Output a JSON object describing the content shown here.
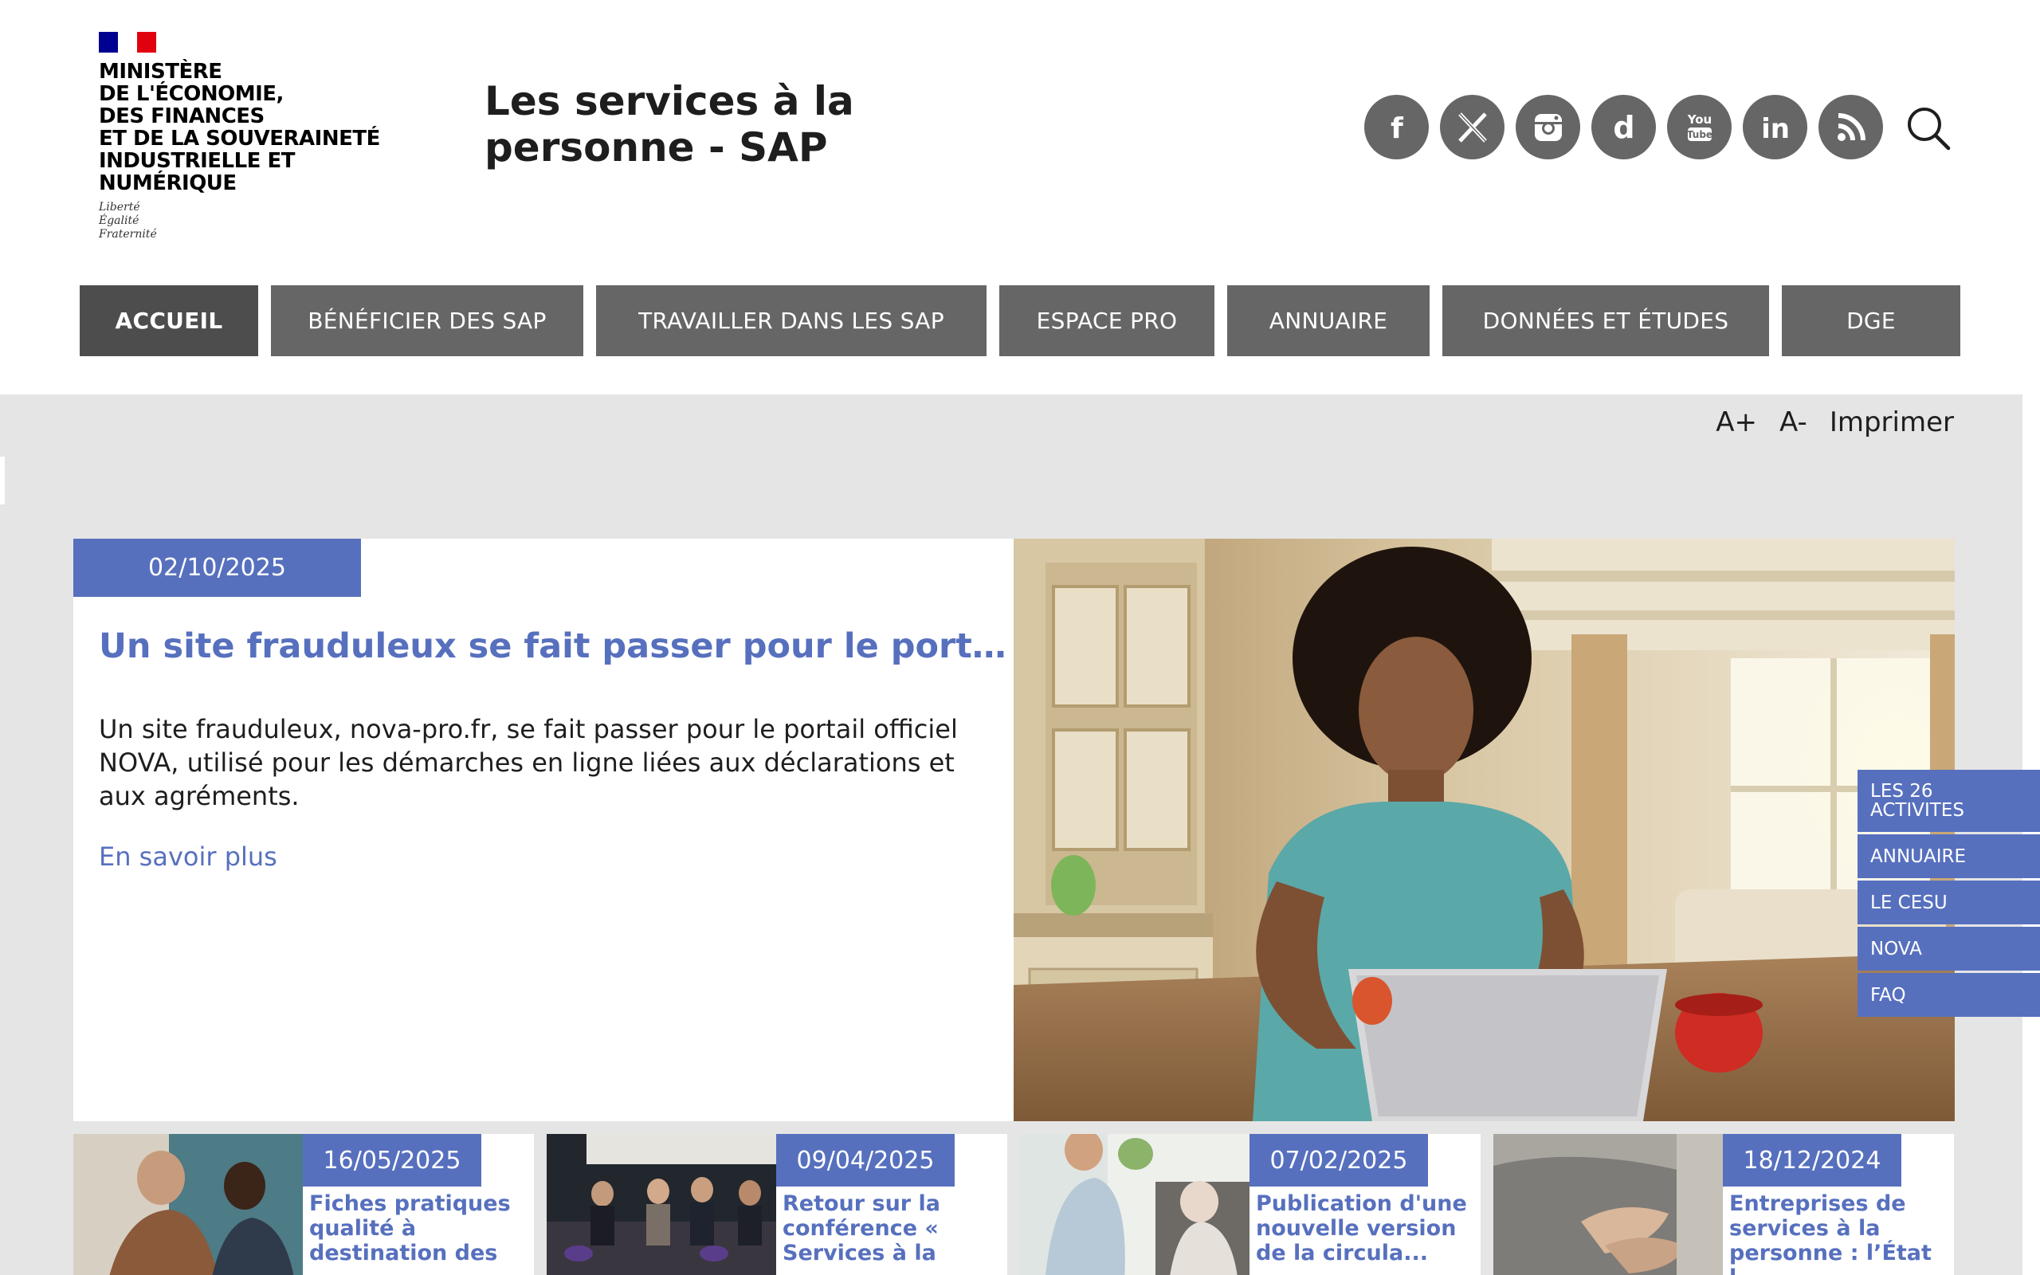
{
  "header": {
    "ministry": "MINISTÈRE\nDE L'ÉCONOMIE,\nDES FINANCES\nET DE LA SOUVERAINETÉ\nINDUSTRIELLE ET NUMÉRIQUE",
    "motto": "Liberté\nÉgalité\nFraternité",
    "site_title": "Les services à la\npersonne - SAP",
    "socials": [
      {
        "icon": "facebook-icon",
        "glyph": "f"
      },
      {
        "icon": "x-icon",
        "glyph": "X"
      },
      {
        "icon": "instagram-icon",
        "glyph": ""
      },
      {
        "icon": "dailymotion-icon",
        "glyph": "d"
      },
      {
        "icon": "youtube-icon",
        "glyph": "You\nTube"
      },
      {
        "icon": "linkedin-icon",
        "glyph": "in"
      },
      {
        "icon": "rss-icon",
        "glyph": ""
      }
    ],
    "search_icon": "search-icon"
  },
  "nav": [
    {
      "label": "ACCUEIL",
      "active": true
    },
    {
      "label": "BÉNÉFICIER DES SAP"
    },
    {
      "label": "TRAVAILLER DANS LES SAP"
    },
    {
      "label": "ESPACE PRO"
    },
    {
      "label": "ANNUAIRE"
    },
    {
      "label": "DONNÉES ET ÉTUDES"
    },
    {
      "label": "DGE"
    }
  ],
  "tools": {
    "increase": "A+",
    "decrease": "A-",
    "print": "Imprimer"
  },
  "featured": {
    "date": "02/10/2025",
    "title": "Un site frauduleux se fait passer pour le portai...",
    "text": "Un site frauduleux, nova-pro.fr, se fait passer pour le portail officiel NOVA, utilisé pour les démarches en ligne liées aux déclarations et aux agréments.",
    "more": "En savoir plus"
  },
  "quick_links": [
    "LES 26\nACTIVITES",
    "ANNUAIRE",
    "LE CESU",
    "NOVA",
    "FAQ"
  ],
  "cards": [
    {
      "date": "16/05/2025",
      "title": "Fiches pratiques qualité à destination des"
    },
    {
      "date": "09/04/2025",
      "title": "Retour sur la conférence « Services à la"
    },
    {
      "date": "07/02/2025",
      "title": "Publication d'une nouvelle version de la circula..."
    },
    {
      "date": "18/12/2024",
      "title": "Entreprises de services à la personne : l’État l..."
    }
  ],
  "colors": {
    "accent": "#5770be",
    "nav": "#666666",
    "nav_active": "#4d4d4d",
    "content_bg": "#e5e5e5"
  }
}
